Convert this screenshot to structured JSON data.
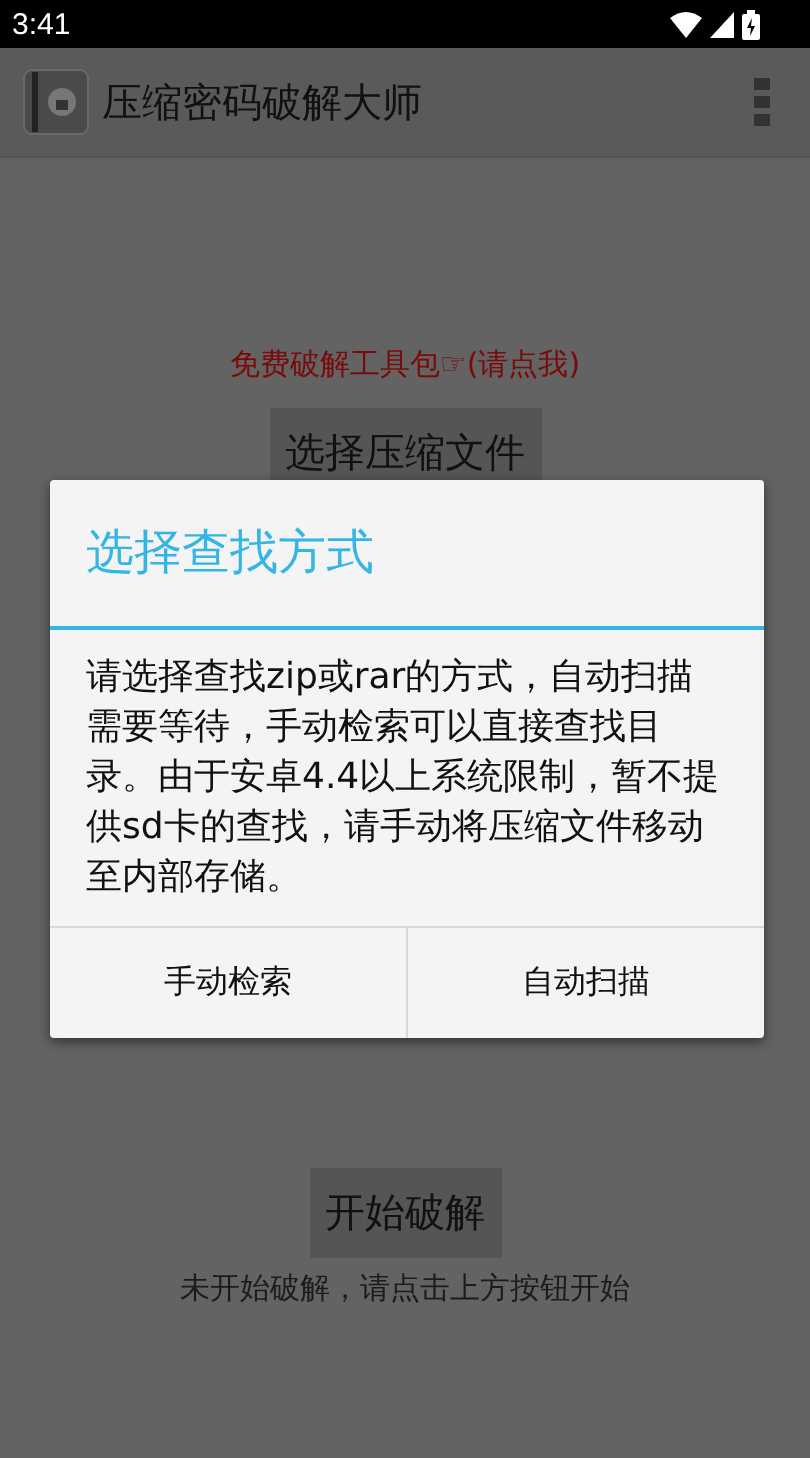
{
  "status_bar": {
    "time": "3:41"
  },
  "app_bar": {
    "title": "压缩密码破解大师"
  },
  "main": {
    "promo_link": "免费破解工具包☞(请点我)",
    "select_button": "选择压缩文件",
    "start_button": "开始破解",
    "status_text": "未开始破解，请点击上方按钮开始"
  },
  "dialog": {
    "title": "选择查找方式",
    "message": "请选择查找zip或rar的方式，自动扫描需要等待，手动检索可以直接查找目录。由于安卓4.4以上系统限制，暂不提供sd卡的查找，请手动将压缩文件移动至内部存储。",
    "buttons": [
      {
        "label": "手动检索"
      },
      {
        "label": "自动扫描"
      }
    ]
  }
}
